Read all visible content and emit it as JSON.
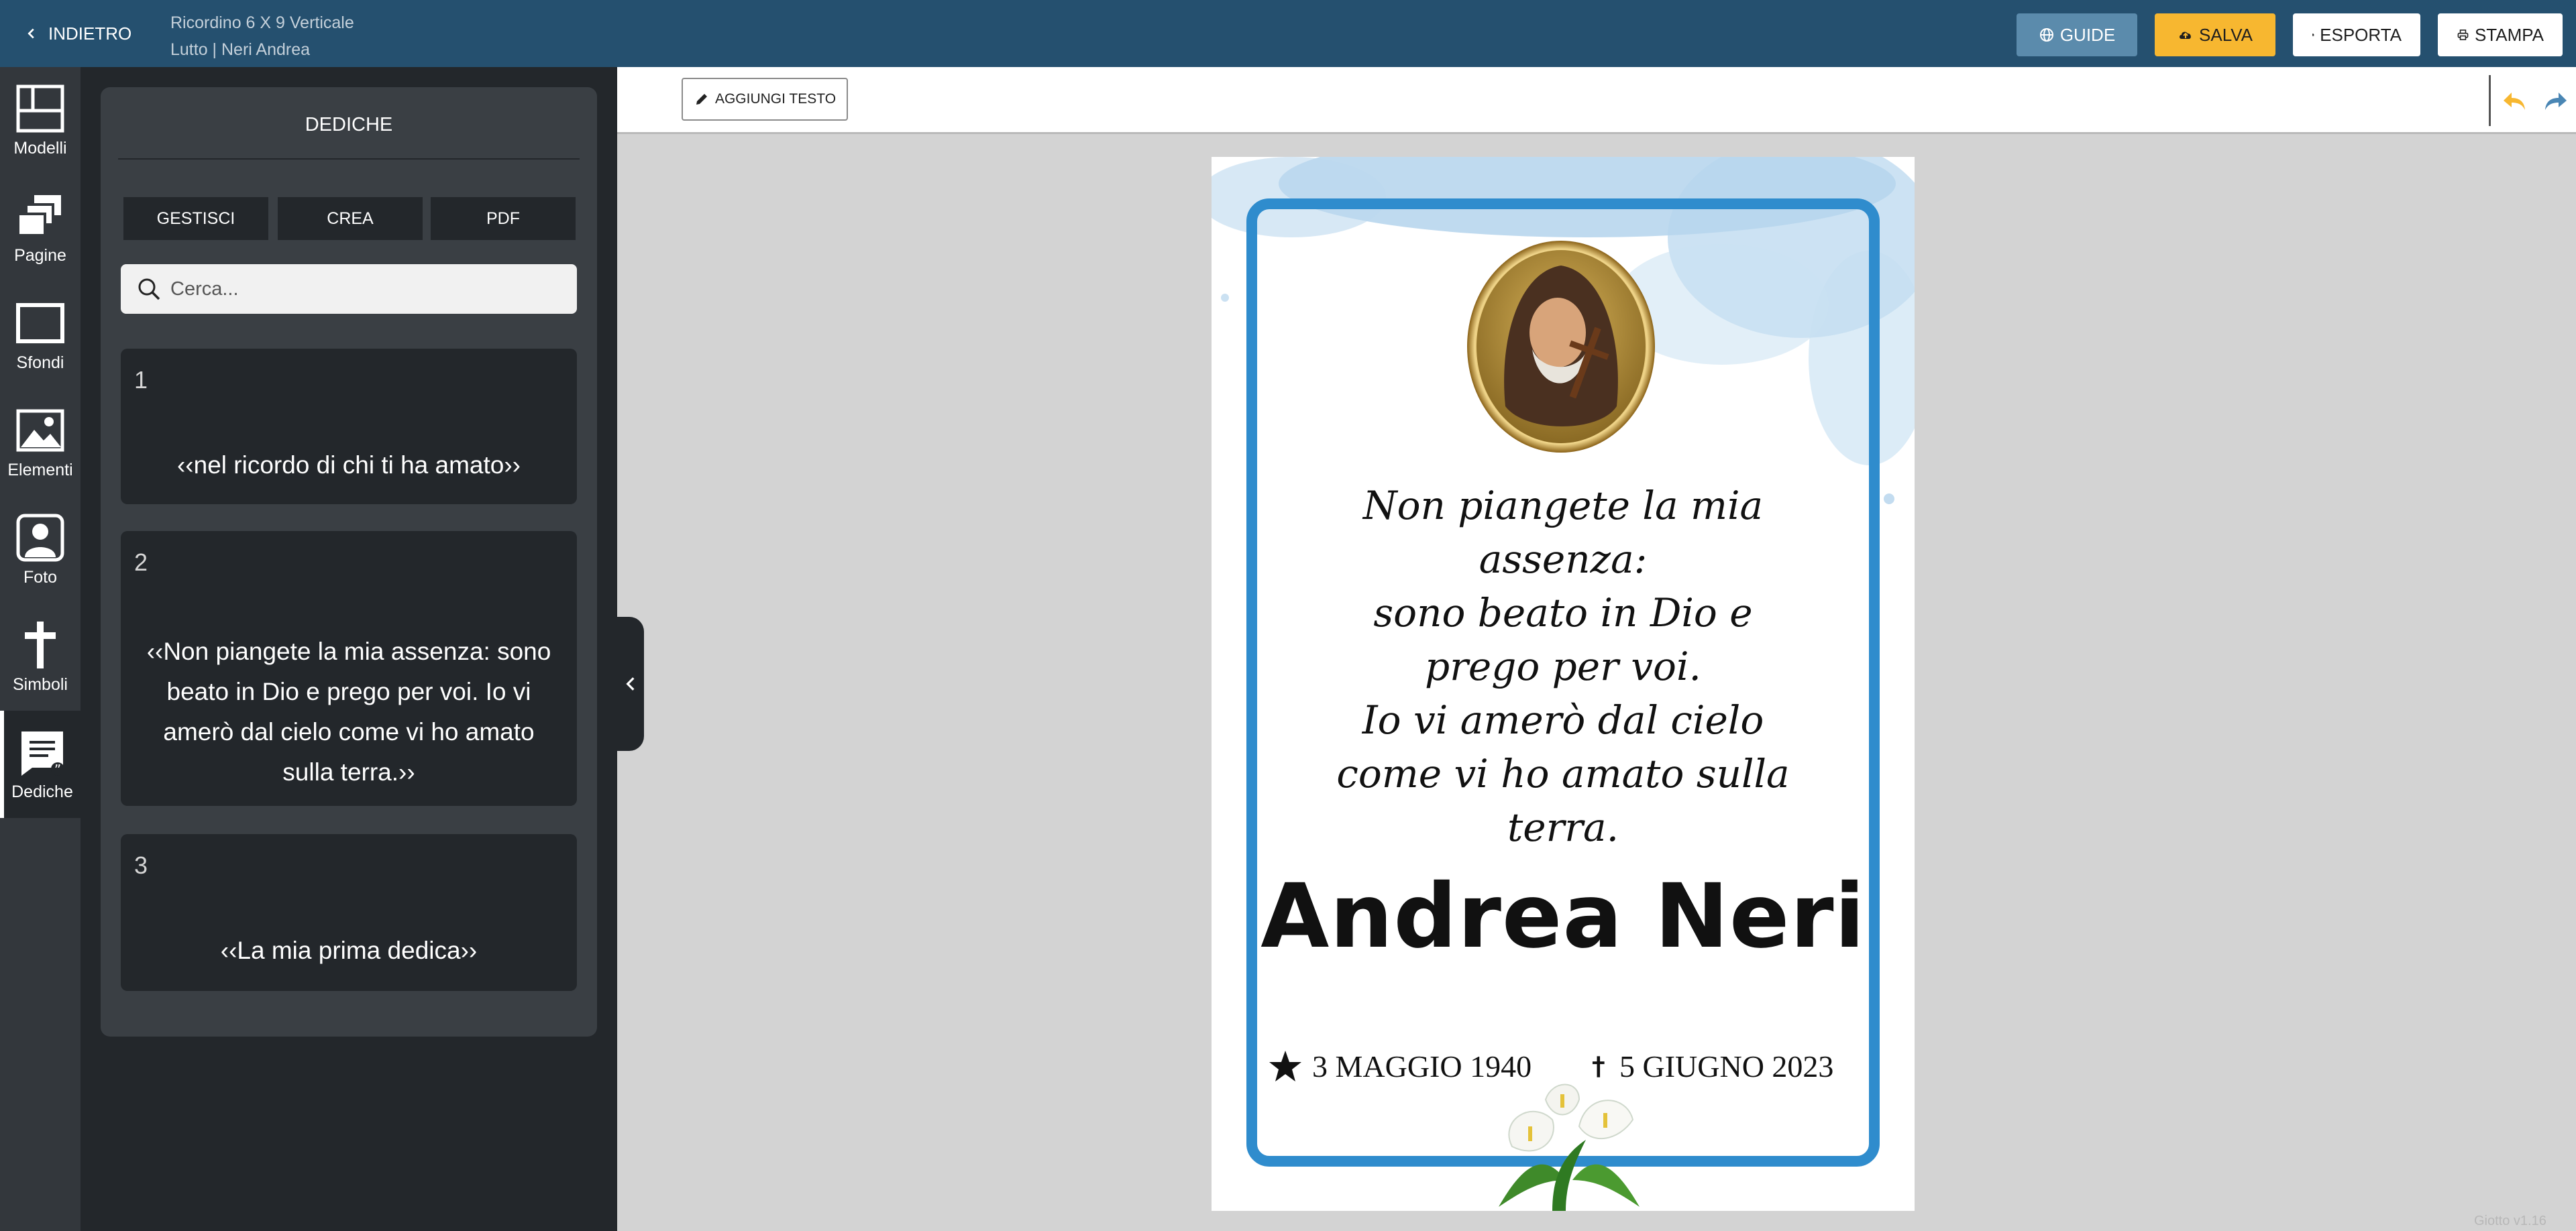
{
  "header": {
    "back_label": "INDIETRO",
    "doc_title_line1": "Ricordino 6 X 9 Verticale",
    "doc_title_line2": "Lutto | Neri Andrea",
    "buttons": {
      "guide": "GUIDE",
      "salva": "SALVA",
      "esporta": "ESPORTA",
      "stampa": "STAMPA"
    }
  },
  "rail": {
    "items": [
      {
        "label": "Modelli",
        "icon": "layout-icon"
      },
      {
        "label": "Pagine",
        "icon": "pages-icon"
      },
      {
        "label": "Sfondi",
        "icon": "background-icon"
      },
      {
        "label": "Elementi",
        "icon": "image-icon"
      },
      {
        "label": "Foto",
        "icon": "person-icon"
      },
      {
        "label": "Simboli",
        "icon": "cross-icon"
      },
      {
        "label": "Dediche",
        "icon": "dedication-icon",
        "active": true
      }
    ]
  },
  "panel": {
    "title": "DEDICHE",
    "tabs": [
      "GESTISCI",
      "CREA",
      "PDF"
    ],
    "search_placeholder": "Cerca...",
    "cards": [
      {
        "number": "1",
        "text": "‹‹nel ricordo di chi ti ha amato››"
      },
      {
        "number": "2",
        "text": "‹‹Non piangete la mia assenza: sono beato in Dio e prego per voi. Io vi amerò dal cielo come vi ho amato sulla terra.››"
      },
      {
        "number": "3",
        "text": "‹‹La mia prima dedica››"
      }
    ]
  },
  "toolbar": {
    "add_text_label": "AGGIUNGI TESTO"
  },
  "card_preview": {
    "poem_lines": [
      "Non piangete la mia",
      "assenza:",
      "sono beato in Dio e",
      "prego per voi.",
      "Io vi amerò dal cielo",
      "come vi ho amato sulla",
      "terra."
    ],
    "name": "Andrea Neri",
    "birth_date": "3 MAGGIO 1940",
    "death_date": "5 GIUGNO 2023"
  },
  "footer": {
    "version": "Giotto v1.16"
  },
  "colors": {
    "header_bg": "#25506f",
    "guide_button": "#5b8bac",
    "salva_button": "#f7b730",
    "frame_blue": "#2f8ccd",
    "panel_dark": "#23272b"
  }
}
